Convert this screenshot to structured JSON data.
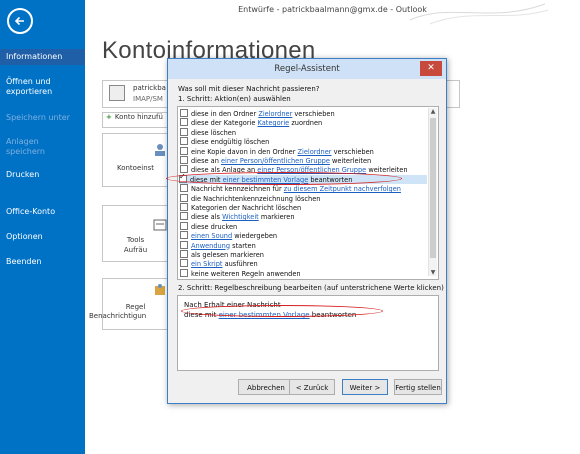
{
  "window": {
    "title": "Entwürfe - patrickbaalmann@gmx.de - Outlook"
  },
  "sidebar": {
    "items": [
      {
        "label": "Informationen"
      },
      {
        "label": "Öffnen und exportieren"
      },
      {
        "label": "Speichern unter"
      },
      {
        "label": "Anlagen speichern"
      },
      {
        "label": "Drucken"
      },
      {
        "label": "Office-Konto"
      },
      {
        "label": "Optionen"
      },
      {
        "label": "Beenden"
      }
    ]
  },
  "main": {
    "title": "Kontoinformationen",
    "account": {
      "email": "patrickba",
      "type": "IMAP/SM"
    },
    "add_account_label": "Konto hinzufü",
    "tiles": [
      {
        "label": "Kontoeinst"
      },
      {
        "label_line1": "Tools",
        "label_line2": "Aufräu"
      },
      {
        "label_line1": "Regel",
        "label_line2": "Benachrichtigun"
      }
    ]
  },
  "dialog": {
    "title": "Regel-Assistent",
    "close_label": "✕",
    "question": "Was soll mit dieser Nachricht passieren?",
    "step1": "1. Schritt: Aktion(en) auswählen",
    "actions": [
      {
        "pre": "diese in den Ordner ",
        "link": "Zielordner",
        "post": " verschieben",
        "checked": false
      },
      {
        "pre": "diese der Kategorie ",
        "link": "Kategorie",
        "post": " zuordnen",
        "checked": false
      },
      {
        "pre": "diese löschen",
        "link": "",
        "post": "",
        "checked": false
      },
      {
        "pre": "diese endgültig löschen",
        "link": "",
        "post": "",
        "checked": false
      },
      {
        "pre": "eine Kopie davon in den Ordner ",
        "link": "Zielordner",
        "post": " verschieben",
        "checked": false
      },
      {
        "pre": "diese an ",
        "link": "einer Person/öffentlichen Gruppe",
        "post": " weiterleiten",
        "checked": false
      },
      {
        "pre": "diese als Anlage an ",
        "link": "einer Person/öffentlichen Gruppe",
        "post": " weiterleiten",
        "checked": false
      },
      {
        "pre": "diese mit ",
        "link": "einer bestimmten Vorlage",
        "post": " beantworten",
        "checked": true
      },
      {
        "pre": "Nachricht kennzeichnen für ",
        "link": "zu diesem Zeitpunkt nachverfolgen",
        "post": "",
        "checked": false
      },
      {
        "pre": "die Nachrichtenkennzeichnung löschen",
        "link": "",
        "post": "",
        "checked": false
      },
      {
        "pre": "Kategorien der Nachricht löschen",
        "link": "",
        "post": "",
        "checked": false
      },
      {
        "pre": "diese als ",
        "link": "Wichtigkeit",
        "post": " markieren",
        "checked": false
      },
      {
        "pre": "diese drucken",
        "link": "",
        "post": "",
        "checked": false
      },
      {
        "pre": "",
        "link": "einen Sound",
        "post": " wiedergeben",
        "checked": false
      },
      {
        "pre": "",
        "link": "Anwendung",
        "post": " starten",
        "checked": false
      },
      {
        "pre": "als gelesen markieren",
        "link": "",
        "post": "",
        "checked": false
      },
      {
        "pre": "",
        "link": "ein Skript",
        "post": " ausführen",
        "checked": false
      },
      {
        "pre": "keine weiteren Regeln anwenden",
        "link": "",
        "post": "",
        "checked": false
      }
    ],
    "step2": "2. Schritt: Regelbeschreibung bearbeiten (auf unterstrichene Werte klicken)",
    "description": {
      "line1": "Nach Erhalt einer Nachricht",
      "line2_pre": "diese mit ",
      "line2_link": "einer bestimmten Vorlage",
      "line2_post": " beantworten"
    },
    "buttons": {
      "cancel": "Abbrechen",
      "back": "< Zurück",
      "next": "Weiter >",
      "finish": "Fertig stellen"
    }
  },
  "colors": {
    "sidebar": "#0072c6",
    "link": "#1a5fc2",
    "highlight": "#d42020"
  }
}
